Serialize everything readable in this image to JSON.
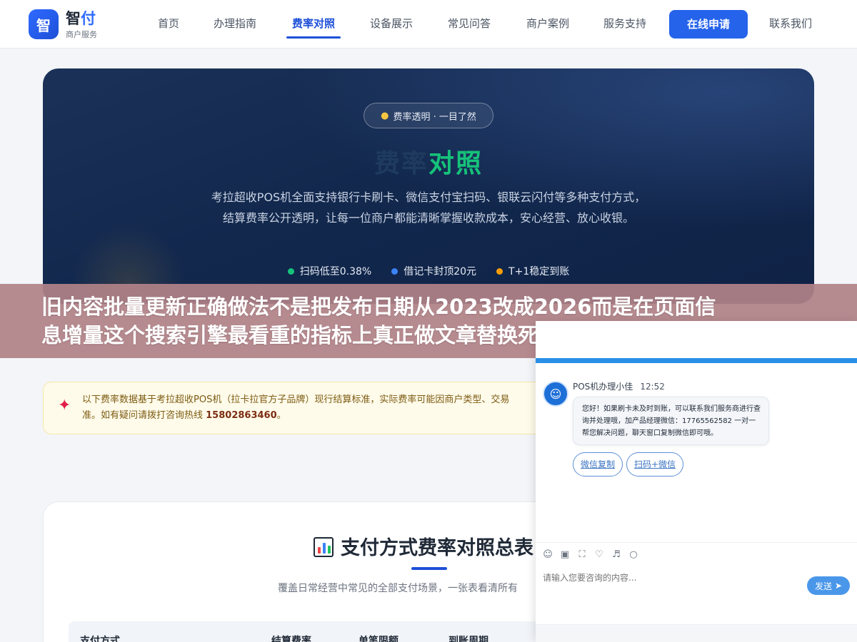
{
  "header": {
    "logo_mark": "智",
    "logo_title_a": "智",
    "logo_title_b": "付",
    "logo_sub": "商户服务",
    "nav": [
      "首页",
      "办理指南",
      "费率对照",
      "设备展示",
      "常见问答",
      "商户案例",
      "服务支持"
    ],
    "active_nav": "费率对照",
    "apply_label": "在线申请",
    "contact_label": "联系我们"
  },
  "hero": {
    "pill_icon": "lightbulb-icon",
    "pill": "费率透明 · 一目了然",
    "title_a": "费率",
    "title_b": "对照",
    "desc": "考拉超收POS机全面支持银行卡刷卡、微信支付宝扫码、银联云闪付等多种支付方式，结算费率公开透明，让每一位商户都能清晰掌握收款成本，安心经营、放心收银。",
    "features": [
      {
        "text": "扫码低至0.38%",
        "color": "#16c27a"
      },
      {
        "text": "借记卡封顶20元",
        "color": "#3b82f6"
      },
      {
        "text": "T+1稳定到账",
        "color": "#f59e0b"
      }
    ]
  },
  "banner": {
    "line1": "旧内容批量更新正确做法不是把发布日期从2023改成2026而是在页面信",
    "line2": "息增量这个搜索引擎最看重的指标上真正做文章替换死工具补新产品加价"
  },
  "notice": {
    "icon": "pushpin-icon",
    "text": "以下费率数据基于考拉超收POS机（拉卡拉官方子品牌）现行结算标准，实际费率可能因商户类型、交易",
    "text2": "准。如有疑问请拨打咨询热线 ",
    "phone": "15802863460",
    "tail": "。"
  },
  "summary": {
    "icon": "bar-chart-icon",
    "title": "支付方式费率对照总表",
    "subtitle": "覆盖日常经营中常见的全部支付场景，一张表看清所有",
    "columns": [
      "支付方式",
      "结算费率",
      "单笔限额",
      "到账周期"
    ]
  },
  "chat": {
    "minimize_icon": "minimize-icon",
    "maximize_icon": "maximize-icon",
    "agent_name": "POS机办理小佳",
    "time": "12:52",
    "message": "您好！如果刷卡未及时到账，可以联系我们服务商进行查询并处理哦，加产品经理微信：17765562582 一对一帮您解决问题，聊天窗口复制微信即可哦。",
    "quick_replies": [
      "微信复制",
      "扫码+微信"
    ],
    "tools": [
      "emoji-icon",
      "image-icon",
      "screenshot-icon",
      "rating-icon",
      "sound-icon",
      "wechat-icon"
    ],
    "input_placeholder": "请输入您要咨询的内容...",
    "send_label": "发送",
    "accent": "#2a8fe6"
  }
}
